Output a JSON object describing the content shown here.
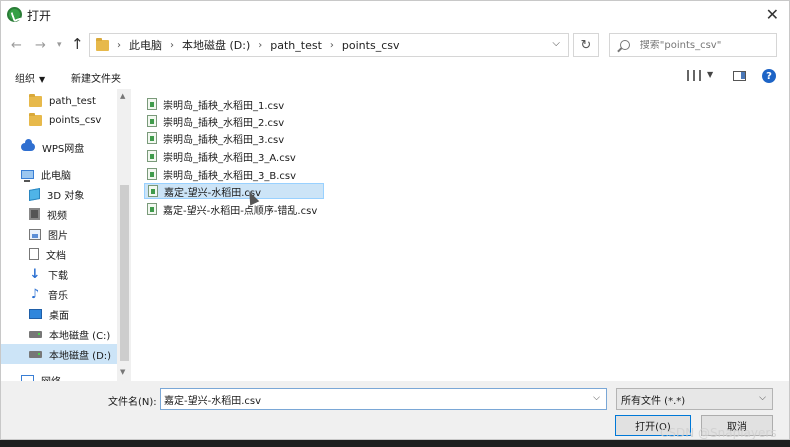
{
  "window": {
    "title": "打开"
  },
  "address": {
    "crumbs": [
      "此电脑",
      "本地磁盘 (D:)",
      "path_test",
      "points_csv"
    ],
    "search_placeholder": "搜索\"points_csv\""
  },
  "toolbar": {
    "organize": "组织",
    "new_folder": "新建文件夹"
  },
  "nav_pane": {
    "items": [
      {
        "label": "path_test",
        "icon": "folder-icon"
      },
      {
        "label": "points_csv",
        "icon": "folder-icon"
      },
      {
        "label": "WPS网盘",
        "icon": "cloud-icon"
      },
      {
        "label": "此电脑",
        "icon": "computer-icon"
      },
      {
        "label": "3D 对象",
        "icon": "cube-icon"
      },
      {
        "label": "视频",
        "icon": "film-icon"
      },
      {
        "label": "图片",
        "icon": "picture-icon"
      },
      {
        "label": "文档",
        "icon": "document-icon"
      },
      {
        "label": "下载",
        "icon": "download-icon"
      },
      {
        "label": "音乐",
        "icon": "music-icon"
      },
      {
        "label": "桌面",
        "icon": "desktop-icon"
      },
      {
        "label": "本地磁盘 (C:)",
        "icon": "drive-icon"
      },
      {
        "label": "本地磁盘 (D:)",
        "icon": "drive-icon"
      },
      {
        "label": "网络",
        "icon": "network-icon"
      }
    ]
  },
  "files": [
    {
      "name": "崇明岛_插秧_水稻田_1.csv"
    },
    {
      "name": "崇明岛_插秧_水稻田_2.csv"
    },
    {
      "name": "崇明岛_插秧_水稻田_3.csv"
    },
    {
      "name": "崇明岛_插秧_水稻田_3_A.csv"
    },
    {
      "name": "崇明岛_插秧_水稻田_3_B.csv"
    },
    {
      "name": "嘉定-望兴-水稻田.csv"
    },
    {
      "name": "嘉定-望兴-水稻田-点顺序-错乱.csv"
    }
  ],
  "bottom": {
    "filename_label": "文件名(N):",
    "filename_value": "嘉定-望兴-水稻田.csv",
    "filetype_value": "所有文件 (*.*)",
    "open_label": "打开(O)",
    "cancel_label": "取消"
  },
  "watermark": "CSDN @Snaplayers"
}
